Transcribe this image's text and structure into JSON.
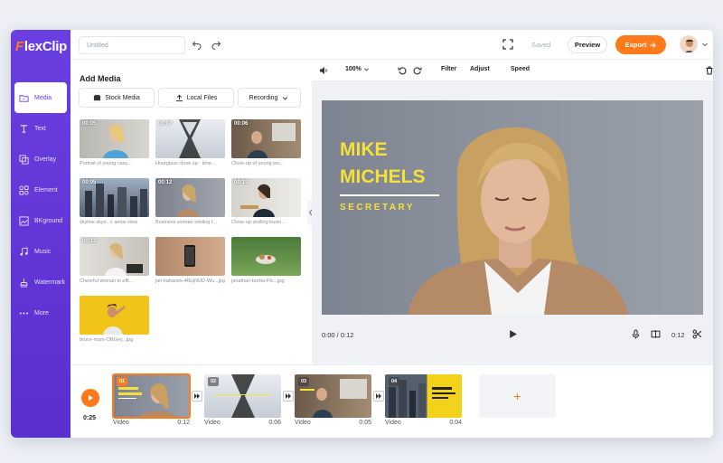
{
  "app": {
    "logo_text": "FlexClip",
    "logo_f": "F",
    "logo_rest": "lexClip"
  },
  "sidebar": {
    "items": [
      {
        "label": "Media",
        "icon": "folder-icon",
        "active": true
      },
      {
        "label": "Text",
        "icon": "text-icon"
      },
      {
        "label": "Overlay",
        "icon": "overlay-icon"
      },
      {
        "label": "Element",
        "icon": "element-icon"
      },
      {
        "label": "BKground",
        "icon": "background-icon"
      },
      {
        "label": "Music",
        "icon": "music-icon"
      },
      {
        "label": "Watermark",
        "icon": "watermark-icon"
      },
      {
        "label": "More",
        "icon": "more-icon"
      }
    ]
  },
  "topbar": {
    "title_placeholder": "Untitled",
    "saved_label": "Saved",
    "preview_label": "Preview",
    "export_label": "Export"
  },
  "media": {
    "title": "Add Media",
    "tabs": [
      {
        "label": "Stock Media",
        "icon": "stock-media-icon"
      },
      {
        "label": "Local Files",
        "icon": "upload-icon"
      },
      {
        "label": "Recording",
        "icon": "chevron-down-icon"
      }
    ],
    "thumbnails": [
      {
        "duration": "00:05",
        "caption": "Portrait of young casu..."
      },
      {
        "duration": "00:07",
        "caption": "Hourglass close up - time..."
      },
      {
        "duration": "00:06",
        "caption": "Close-up of young wo..."
      },
      {
        "duration": "00:05",
        "caption": "skyline skys...s aerial view"
      },
      {
        "duration": "00:12",
        "caption": "Business woman smiling f..."
      },
      {
        "duration": "00:19",
        "caption": "Close-up smiling busin..."
      },
      {
        "duration": "00:12",
        "caption": "Cheerful woman in effi..."
      },
      {
        "duration": "",
        "caption": "jan-kahanek-4fEqNUD-Wu...jpg"
      },
      {
        "duration": "",
        "caption": "jonathan-borba-Ffc...jpg"
      },
      {
        "duration": "",
        "caption": "bruce-mars-OBGey...jpg"
      }
    ]
  },
  "editor_toolbar": {
    "zoom": "100%",
    "filter_label": "Filter",
    "adjust_label": "Adjust",
    "speed_label": "Speed"
  },
  "stage": {
    "name_line1": "MIKE",
    "name_line2": "MICHELS",
    "role": "SECRETARY",
    "accent_color": "#f5e13a"
  },
  "playbar": {
    "current_time": "0:00 / 0:12",
    "clip_duration": "0:12"
  },
  "timeline": {
    "total_time": "0:25",
    "clips": [
      {
        "number": "01",
        "label": "Video",
        "duration": "0:12"
      },
      {
        "number": "02",
        "label": "Video",
        "duration": "0:06"
      },
      {
        "number": "03",
        "label": "Video",
        "duration": "0:05"
      },
      {
        "number": "04",
        "label": "Video",
        "duration": "0:04"
      }
    ],
    "add_label": "+"
  },
  "colors": {
    "brand_purple": "#6a3fe0",
    "accent_orange": "#ff7a1a"
  }
}
